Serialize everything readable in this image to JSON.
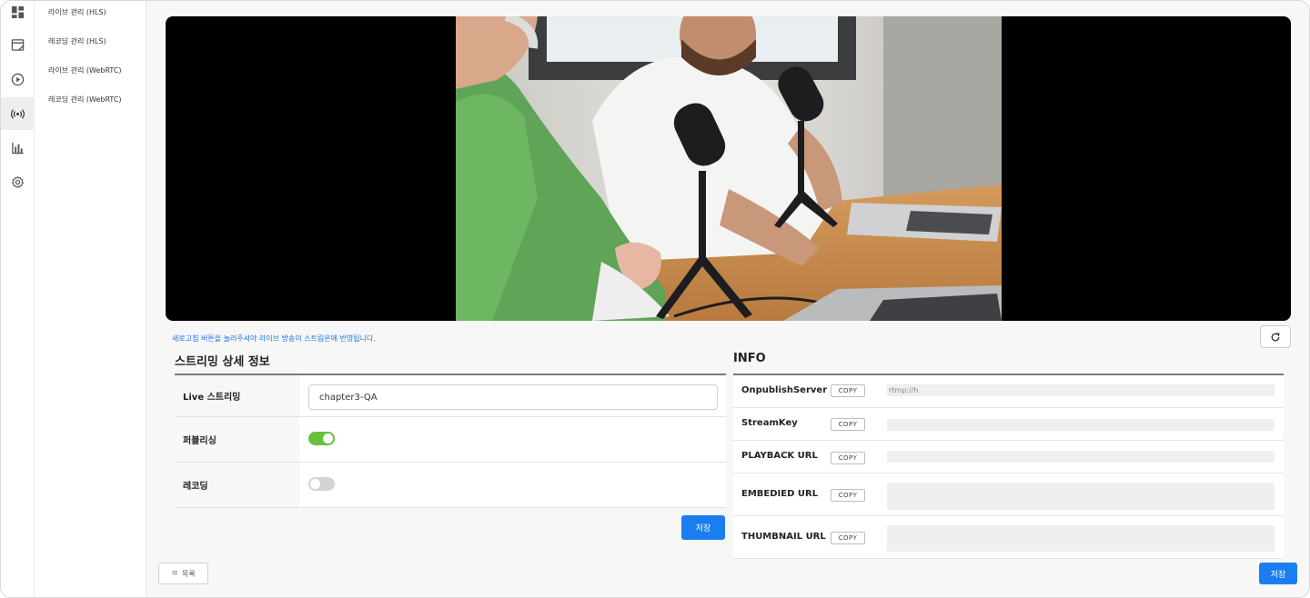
{
  "sidebar": {
    "icons": [
      "dashboard-icon",
      "board-icon",
      "play-icon",
      "broadcast-icon",
      "chart-icon",
      "gear-icon"
    ],
    "items": [
      {
        "label": "라이브 관리 (HLS)"
      },
      {
        "label": "레코딩 관리 (HLS)"
      },
      {
        "label": "라이브 관리 (WebRTC)"
      },
      {
        "label": "레코딩 관리 (WebRTC)"
      }
    ]
  },
  "notice": "새로고침 버튼을 눌러주셔야 라이브 방송이 스트림온에 반영됩니다.",
  "details": {
    "title": "스트리밍 상세 정보",
    "live_stream_label": "Live 스트리밍",
    "live_stream_value": "chapter3-QA",
    "publishing_label": "퍼블리싱",
    "publishing_on": true,
    "recording_label": "레코딩",
    "recording_on": false,
    "save_label": "저장"
  },
  "info": {
    "title": "INFO",
    "copy_label": "COPY",
    "rows": [
      {
        "label": "OnpublishServer",
        "value": "rtmp://h"
      },
      {
        "label": "StreamKey",
        "value": ""
      },
      {
        "label": "PLAYBACK URL",
        "value": ""
      },
      {
        "label": "EMBEDIED URL",
        "value": ""
      },
      {
        "label": "THUMBNAIL URL",
        "value": ""
      }
    ],
    "save_label": "저장"
  },
  "list_button_label": "목록",
  "colors": {
    "accent": "#1a7ef0",
    "toggle_on": "#67c23a",
    "notice": "#1a73e8"
  }
}
